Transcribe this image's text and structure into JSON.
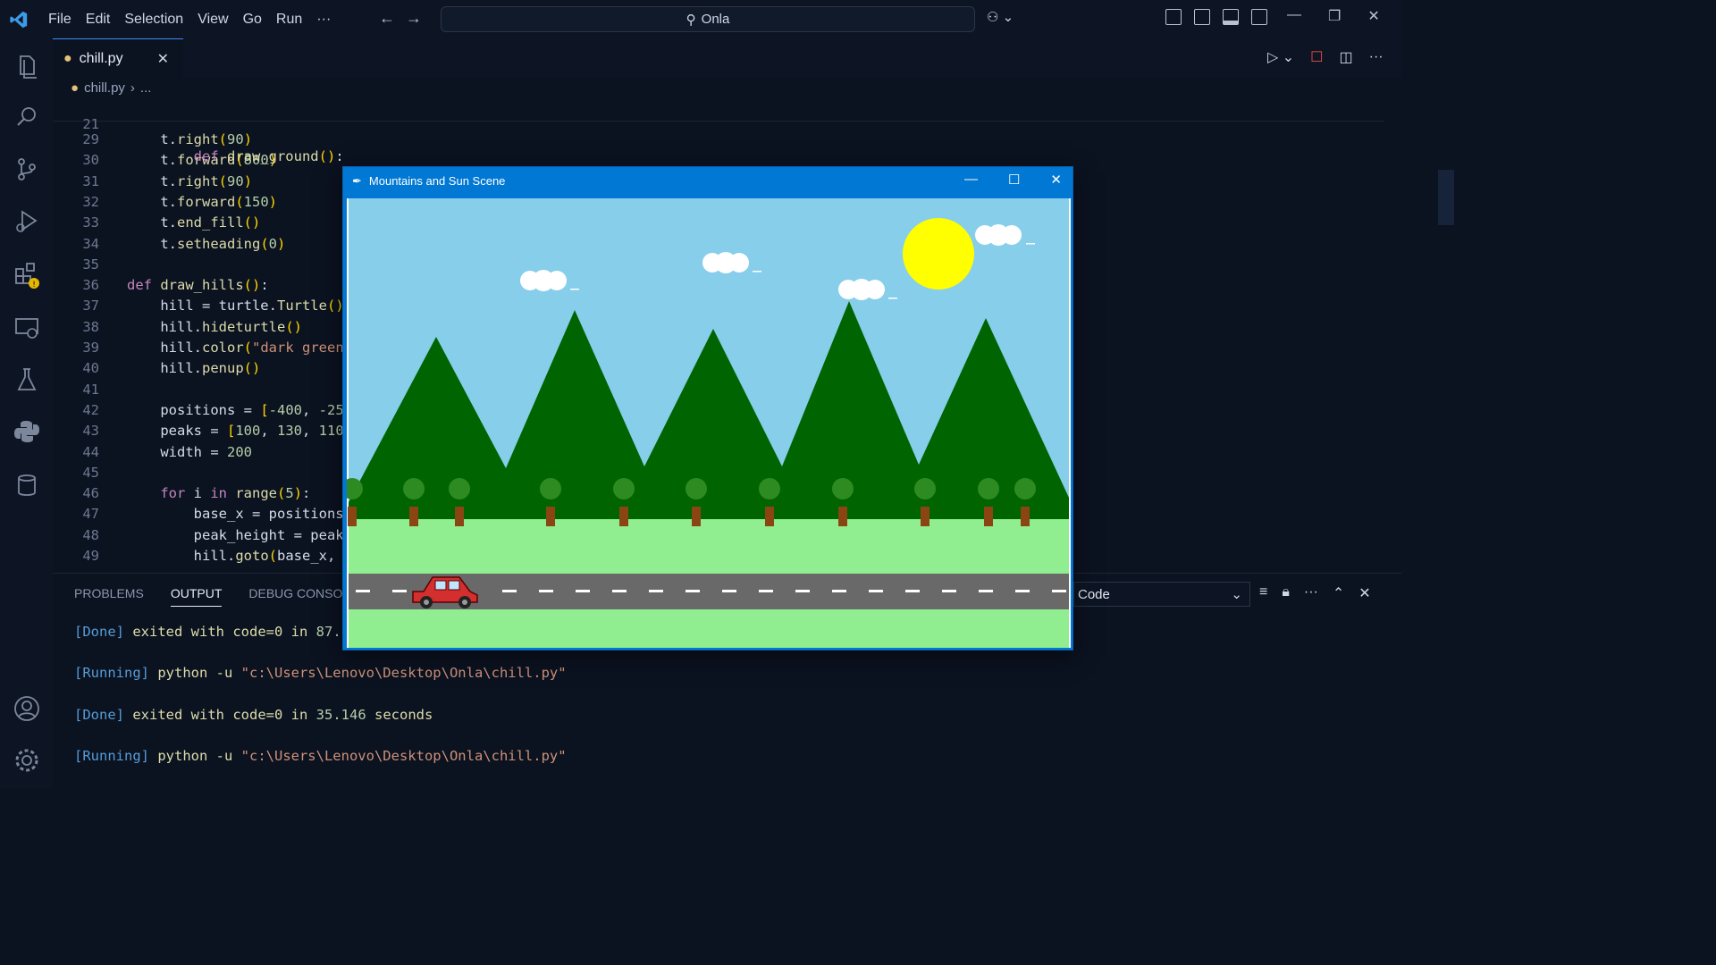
{
  "titlebar": {
    "menu": [
      "File",
      "Edit",
      "Selection",
      "View",
      "Go",
      "Run",
      "···"
    ],
    "search": "Onla"
  },
  "tab": {
    "label": "chill.py"
  },
  "breadcrumb": {
    "file": "chill.py",
    "rest": "..."
  },
  "editor": {
    "sticky": {
      "num": "21",
      "tokens": [
        [
          "kw",
          "def "
        ],
        [
          "fn",
          "draw_ground"
        ],
        [
          "par",
          "()"
        ],
        [
          "",
          ""
        ],
        [
          "",
          ":"
        ]
      ]
    },
    "lines": [
      {
        "num": "29",
        "tokens": [
          [
            "",
            "    t."
          ],
          [
            "fn",
            "right"
          ],
          [
            "par",
            "("
          ],
          [
            "num",
            "90"
          ],
          [
            "par",
            ")"
          ]
        ]
      },
      {
        "num": "30",
        "tokens": [
          [
            "",
            "    t."
          ],
          [
            "fn",
            "forward"
          ],
          [
            "par",
            "("
          ],
          [
            "num",
            "800"
          ],
          [
            "par",
            ")"
          ]
        ]
      },
      {
        "num": "31",
        "tokens": [
          [
            "",
            "    t."
          ],
          [
            "fn",
            "right"
          ],
          [
            "par",
            "("
          ],
          [
            "num",
            "90"
          ],
          [
            "par",
            ")"
          ]
        ]
      },
      {
        "num": "32",
        "tokens": [
          [
            "",
            "    t."
          ],
          [
            "fn",
            "forward"
          ],
          [
            "par",
            "("
          ],
          [
            "num",
            "150"
          ],
          [
            "par",
            ")"
          ]
        ]
      },
      {
        "num": "33",
        "tokens": [
          [
            "",
            "    t."
          ],
          [
            "fn",
            "end_fill"
          ],
          [
            "par",
            "()"
          ]
        ]
      },
      {
        "num": "34",
        "tokens": [
          [
            "",
            "    t."
          ],
          [
            "fn",
            "setheading"
          ],
          [
            "par",
            "("
          ],
          [
            "num",
            "0"
          ],
          [
            "par",
            ")"
          ]
        ]
      },
      {
        "num": "35",
        "tokens": []
      },
      {
        "num": "36",
        "tokens": [
          [
            "kw",
            "def "
          ],
          [
            "fn",
            "draw_hills"
          ],
          [
            "par",
            "()"
          ],
          [
            "",
            ":"
          ]
        ]
      },
      {
        "num": "37",
        "tokens": [
          [
            "",
            "    hill = turtle."
          ],
          [
            "fn",
            "Turtle"
          ],
          [
            "par",
            "()"
          ]
        ]
      },
      {
        "num": "38",
        "tokens": [
          [
            "",
            "    hill."
          ],
          [
            "fn",
            "hideturtle"
          ],
          [
            "par",
            "()"
          ]
        ]
      },
      {
        "num": "39",
        "tokens": [
          [
            "",
            "    hill."
          ],
          [
            "fn",
            "color"
          ],
          [
            "par",
            "("
          ],
          [
            "str",
            "\"dark green"
          ]
        ]
      },
      {
        "num": "40",
        "tokens": [
          [
            "",
            "    hill."
          ],
          [
            "fn",
            "penup"
          ],
          [
            "par",
            "()"
          ]
        ]
      },
      {
        "num": "41",
        "tokens": []
      },
      {
        "num": "42",
        "tokens": [
          [
            "",
            "    positions = "
          ],
          [
            "par",
            "["
          ],
          [
            "num",
            "-400"
          ],
          [
            "",
            ", "
          ],
          [
            "num",
            "-25"
          ]
        ]
      },
      {
        "num": "43",
        "tokens": [
          [
            "",
            "    peaks = "
          ],
          [
            "par",
            "["
          ],
          [
            "num",
            "100"
          ],
          [
            "",
            ", "
          ],
          [
            "num",
            "130"
          ],
          [
            "",
            ", "
          ],
          [
            "num",
            "110"
          ]
        ]
      },
      {
        "num": "44",
        "tokens": [
          [
            "",
            "    width = "
          ],
          [
            "num",
            "200"
          ]
        ]
      },
      {
        "num": "45",
        "tokens": []
      },
      {
        "num": "46",
        "tokens": [
          [
            "kw",
            "    for "
          ],
          [
            "",
            "i "
          ],
          [
            "kw",
            "in "
          ],
          [
            "fn",
            "range"
          ],
          [
            "par",
            "("
          ],
          [
            "num",
            "5"
          ],
          [
            "par",
            ")"
          ],
          [
            "",
            ":"
          ]
        ]
      },
      {
        "num": "47",
        "tokens": [
          [
            "",
            "        base_x = positions"
          ]
        ]
      },
      {
        "num": "48",
        "tokens": [
          [
            "",
            "        peak_height = peak"
          ]
        ]
      },
      {
        "num": "49",
        "tokens": [
          [
            "",
            "        hill."
          ],
          [
            "fn",
            "goto"
          ],
          [
            "par",
            "("
          ],
          [
            "",
            "base_x, "
          ]
        ]
      }
    ]
  },
  "panel": {
    "tabs": [
      "PROBLEMS",
      "OUTPUT",
      "DEBUG CONSOLE"
    ],
    "output_channel": "Code",
    "lines": [
      {
        "tag": "[Done]",
        "text": " exited with ",
        "k": "code",
        "eq": "=0 in ",
        "val": "87.",
        "tail": ""
      },
      {
        "tag": "[Running]",
        "cmd": " python -u ",
        "path": "\"c:\\Users\\Lenovo\\Desktop\\Onla\\chill.py\""
      },
      {
        "tag": "[Done]",
        "text": " exited with ",
        "k": "code",
        "eq": "=0 in ",
        "val": "35.146",
        "tail": " seconds"
      },
      {
        "tag": "[Running]",
        "cmd": " python -u ",
        "path": "\"c:\\Users\\Lenovo\\Desktop\\Onla\\chill.py\""
      }
    ]
  },
  "turtle_window": {
    "title": "Mountains and Sun Scene",
    "colors": {
      "sky": "#87ceeb",
      "mountain": "#006400",
      "grass": "#90ee90",
      "road": "#696969",
      "sun": "#ffff00",
      "trunk": "#8b4513",
      "car": "#d32f2f"
    }
  }
}
